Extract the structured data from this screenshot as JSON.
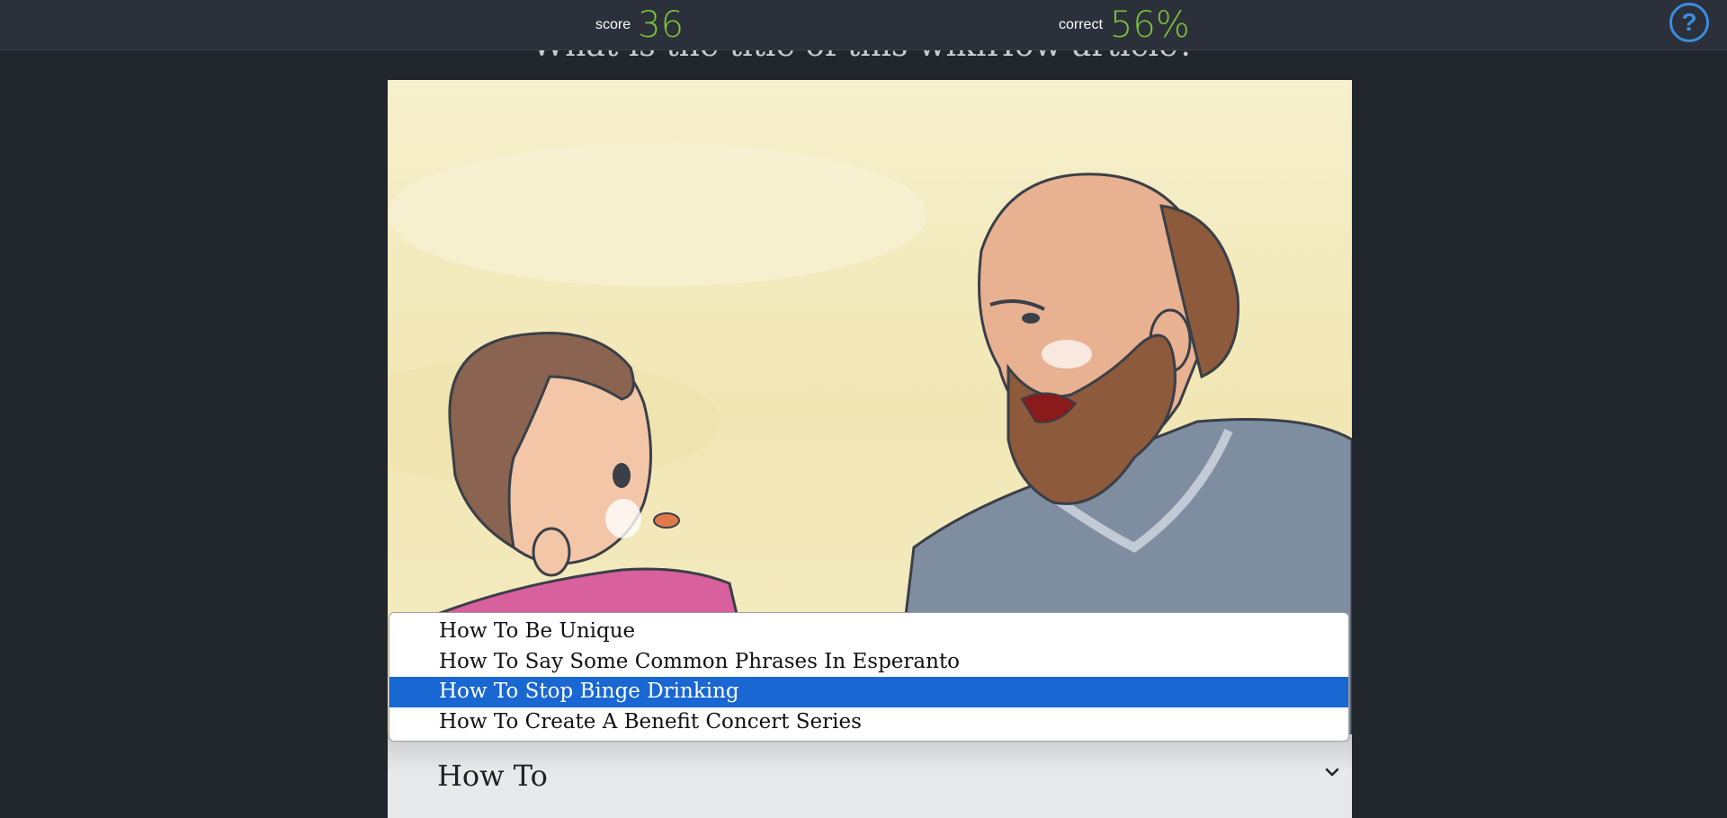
{
  "header": {
    "score_label": "score",
    "score_value": "36",
    "correct_label": "correct",
    "correct_value": "56%",
    "help_label": "?"
  },
  "question": {
    "text": "What is the title of this wikiHow article?"
  },
  "dropdown": {
    "options": [
      "How To Be Unique",
      "How To Say Some Common Phrases In Esperanto",
      "How To Stop Binge Drinking",
      "How To Create A Benefit Concert Series"
    ],
    "highlighted_index": 2,
    "current_value": "How To"
  },
  "colors": {
    "accent_green": "#7bc13a",
    "help_blue": "#3a8dde",
    "highlight_blue": "#1967d2",
    "background": "#22262d",
    "topbar": "#2b303a"
  }
}
